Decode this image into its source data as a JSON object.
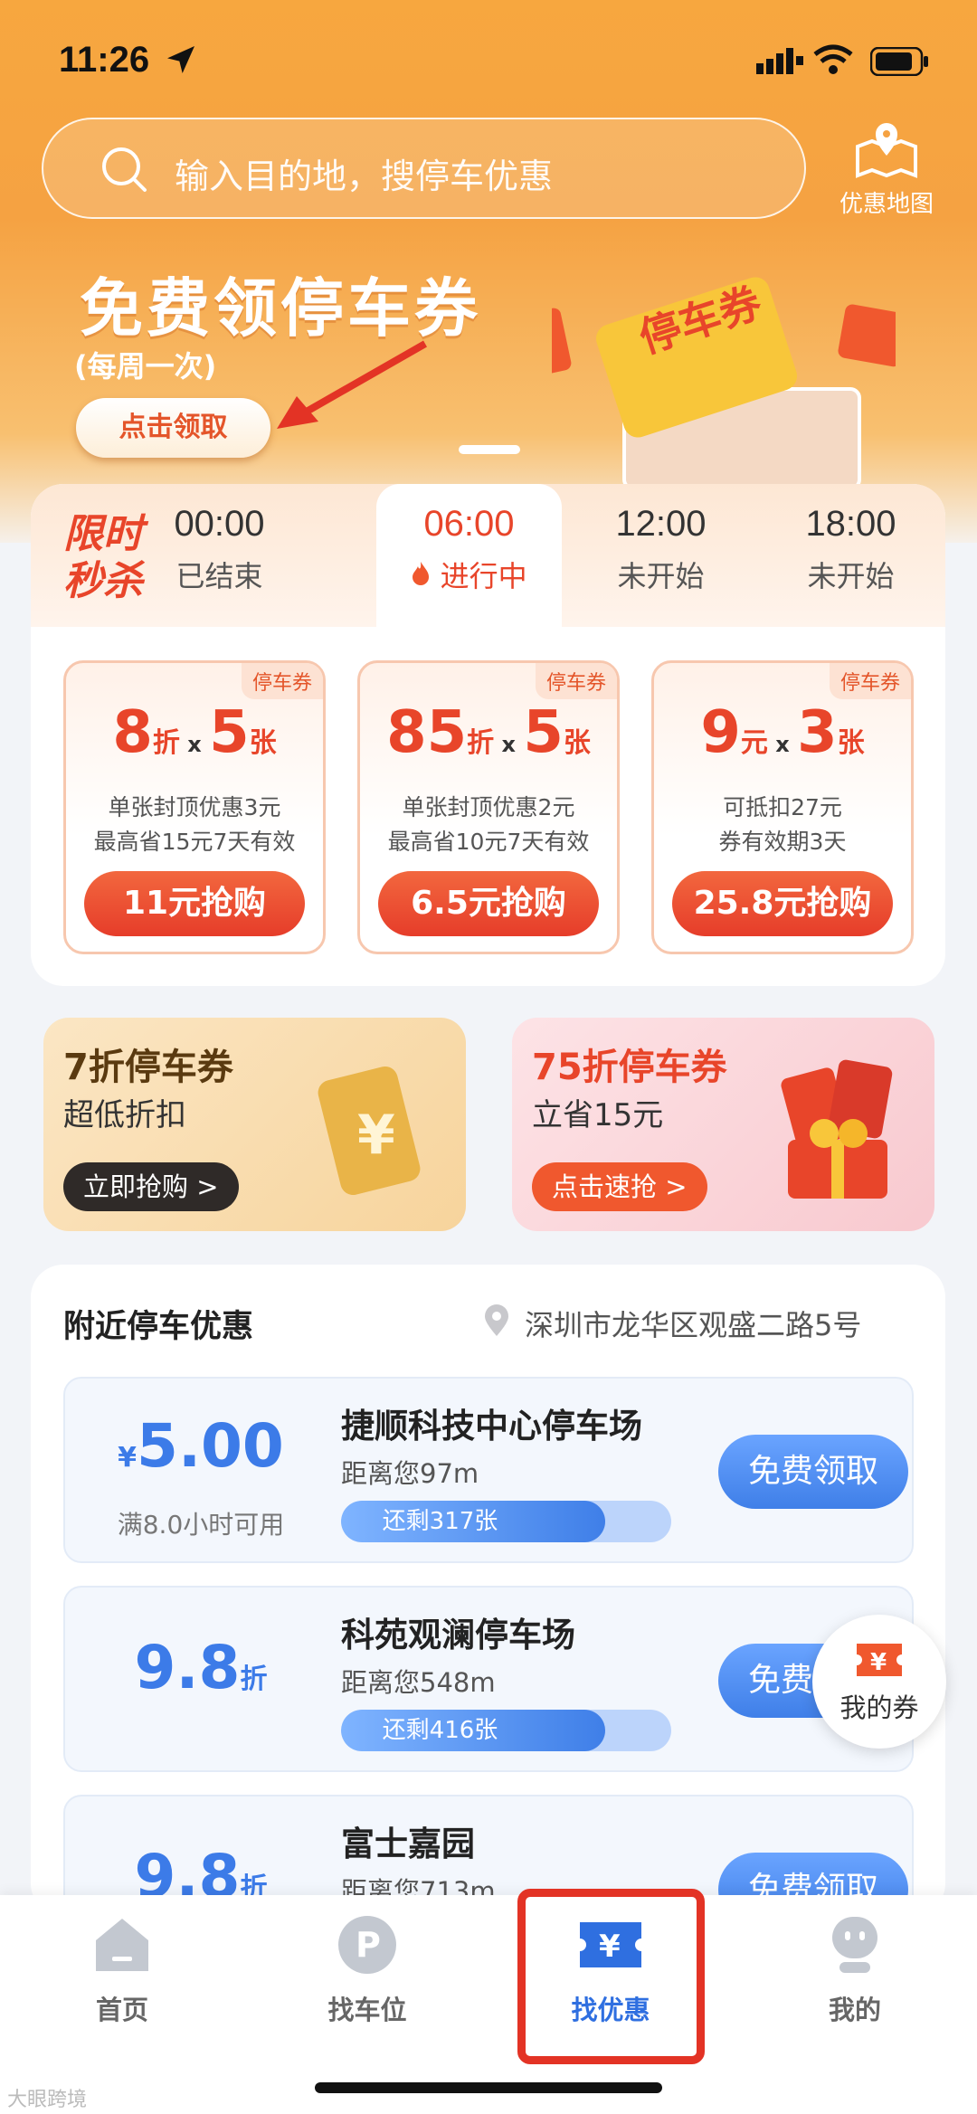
{
  "status_bar": {
    "time": "11:26"
  },
  "search": {
    "placeholder": "输入目的地，搜停车优惠"
  },
  "map_button": {
    "label": "优惠地图"
  },
  "banner": {
    "title": "免费领停车券",
    "subtitle": "(每周一次)",
    "cta": "点击领取",
    "ticket_text": "停车券"
  },
  "flash_sale": {
    "label_line1": "限时",
    "label_line2": "秒杀",
    "slots": [
      {
        "time": "00:00",
        "status": "已结束",
        "active": false
      },
      {
        "time": "06:00",
        "status": "进行中",
        "active": true
      },
      {
        "time": "12:00",
        "status": "未开始",
        "active": false
      },
      {
        "time": "18:00",
        "status": "未开始",
        "active": false
      }
    ],
    "coupons": [
      {
        "tag": "停车券",
        "main_value": "8",
        "main_unit": "折",
        "x": "x",
        "count": "5",
        "count_unit": "张",
        "line1": "单张封顶优惠3元",
        "line2": "最高省15元7天有效",
        "buy": "11元抢购"
      },
      {
        "tag": "停车券",
        "main_value": "85",
        "main_unit": "折",
        "x": "x",
        "count": "5",
        "count_unit": "张",
        "line1": "单张封顶优惠2元",
        "line2": "最高省10元7天有效",
        "buy": "6.5元抢购"
      },
      {
        "tag": "停车券",
        "main_value": "9",
        "main_unit": "元",
        "x": "x",
        "count": "3",
        "count_unit": "张",
        "line1": "可抵扣27元",
        "line2": "券有效期3天",
        "buy": "25.8元抢购"
      }
    ]
  },
  "promos": [
    {
      "title": "7折停车券",
      "subtitle": "超低折扣",
      "cta": "立即抢购 >"
    },
    {
      "title": "75折停车券",
      "subtitle": "立省15元",
      "cta": "点击速抢 >"
    }
  ],
  "nearby": {
    "title": "附近停车优惠",
    "location": "深圳市龙华区观盛二路5号",
    "lots": [
      {
        "price_prefix": "¥",
        "price": "5.00",
        "price_suffix": "",
        "condition": "满8.0小时可用",
        "name": "捷顺科技中心停车场",
        "distance": "距离您97m",
        "remaining": "还剩317张",
        "remaining_fraction": 0.8,
        "action": "免费领取"
      },
      {
        "price_prefix": "",
        "price": "9.8",
        "price_suffix": "折",
        "condition": "",
        "name": "科苑观澜停车场",
        "distance": "距离您548m",
        "remaining": "还剩416张",
        "remaining_fraction": 0.8,
        "action": "免费领取"
      },
      {
        "price_prefix": "",
        "price": "9.8",
        "price_suffix": "折",
        "condition": "",
        "name": "富士嘉园",
        "distance": "距离您713m",
        "remaining": "",
        "remaining_fraction": 0,
        "action": "免费领取"
      }
    ]
  },
  "my_coupons": {
    "label": "我的券"
  },
  "tabbar": [
    {
      "label": "首页",
      "active": false
    },
    {
      "label": "找车位",
      "active": false
    },
    {
      "label": "找优惠",
      "active": true
    },
    {
      "label": "我的",
      "active": false
    }
  ],
  "watermark": "大眼跨境",
  "colors": {
    "accent_orange": "#f5a242",
    "sale_red": "#e8452a",
    "brand_blue": "#3f7fe8",
    "highlight_red": "#e33325"
  }
}
